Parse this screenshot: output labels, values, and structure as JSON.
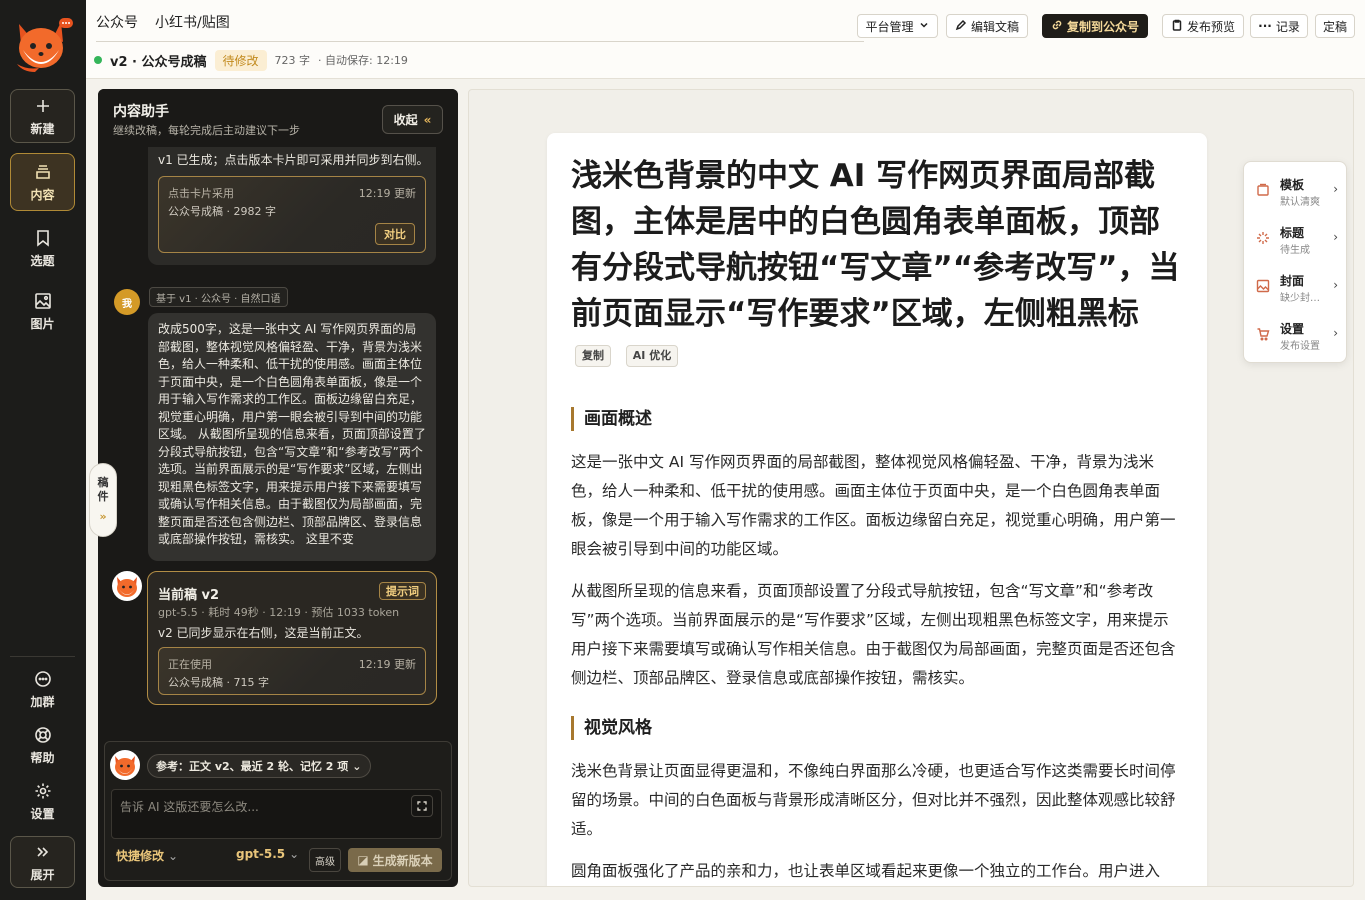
{
  "rail": {
    "new_label": "新建",
    "content_label": "内容",
    "topic_label": "选题",
    "image_label": "图片",
    "group_label": "加群",
    "help_label": "帮助",
    "settings_label": "设置",
    "expand_label": "展开"
  },
  "header": {
    "tabs": [
      "公众号",
      "小红书/贴图"
    ],
    "doc_title": "v2 · 公众号成稿",
    "status_badge": "待修改",
    "word_count": "723 字",
    "autosave": "· 自动保存: 12:19",
    "buttons": {
      "platform": "平台管理",
      "edit": "编辑文稿",
      "copy": "复制到公众号",
      "preview": "发布预览",
      "record": "记录",
      "finalize": "定稿"
    }
  },
  "assistant": {
    "title": "内容助手",
    "subtitle": "继续改稿，每轮完成后主动建议下一步",
    "collapse_label": "收起",
    "prev_message": "v1 已生成；点击版本卡片即可采用并同步到右侧。",
    "prev_card": {
      "label": "点击卡片采用",
      "time": "12:19 更新",
      "desc": "公众号成稿 · 2982 字",
      "compare_label": "对比"
    },
    "user_avatar": "我",
    "user_ref": "基于 v1 · 公众号 · 自然口语",
    "user_message": "改成500字，这是一张中文 AI 写作网页界面的局部截图，整体视觉风格偏轻盈、干净，背景为浅米色，给人一种柔和、低干扰的使用感。画面主体位于页面中央，是一个白色圆角表单面板，像是一个用于输入写作需求的工作区。面板边缘留白充足，视觉重心明确，用户第一眼会被引导到中间的功能区域。 从截图所呈现的信息来看，页面顶部设置了分段式导航按钮，包含“写文章”和“参考改写”两个选项。当前界面展示的是“写作要求”区域，左侧出现粗黑色标签文字，用来提示用户接下来需要填写或确认写作相关信息。由于截图仅为局部画面，完整页面是否还包含侧边栏、顶部品牌区、登录信息或底部操作按钮，需核实。 这里不变",
    "draft_tab": [
      "稿",
      "件"
    ],
    "current": {
      "title": "当前稿 v2",
      "tip_label": "提示词",
      "meta": "gpt-5.5 · 耗时 49秒 · 12:19 · 预估 1033 token",
      "desc": "v2 已同步显示在右侧，这是当前正文。",
      "card_label": "正在使用",
      "card_time": "12:19 更新",
      "card_desc": "公众号成稿 · 715 字"
    },
    "composer": {
      "ref_chip": "参考：正文 v2、最近 2 轮、记忆 2 项",
      "placeholder": "告诉 AI 这版还要怎么改...",
      "quick_label": "快捷修改",
      "model_label": "gpt-5.5",
      "advanced_label": "高级",
      "generate_label": "生成新版本"
    }
  },
  "article": {
    "title": "浅米色背景的中文 AI 写作网页界面局部截图，主体是居中的白色圆角表单面板，顶部有分段式导航按钮“写文章”“参考改写”，当前页面显示“写作要求”区域，左侧粗黑标",
    "copy_chip": "复制",
    "optimize_chip": "AI 优化",
    "sections": [
      {
        "heading": "画面概述",
        "paragraphs": [
          "这是一张中文 AI 写作网页界面的局部截图，整体视觉风格偏轻盈、干净，背景为浅米色，给人一种柔和、低干扰的使用感。画面主体位于页面中央，是一个白色圆角表单面板，像是一个用于输入写作需求的工作区。面板边缘留白充足，视觉重心明确，用户第一眼会被引导到中间的功能区域。",
          "从截图所呈现的信息来看，页面顶部设置了分段式导航按钮，包含“写文章”和“参考改写”两个选项。当前界面展示的是“写作要求”区域，左侧出现粗黑色标签文字，用来提示用户接下来需要填写或确认写作相关信息。由于截图仅为局部画面，完整页面是否还包含侧边栏、顶部品牌区、登录信息或底部操作按钮，需核实。"
        ]
      },
      {
        "heading": "视觉风格",
        "paragraphs": [
          "浅米色背景让页面显得更温和，不像纯白界面那么冷硬，也更适合写作这类需要长时间停留的场景。中间的白色面板与背景形成清晰区分，但对比并不强烈，因此整体观感比较舒适。",
          "圆角面板强化了产品的亲和力，也让表单区域看起来更像一个独立的工作台。用户进入"
        ]
      }
    ]
  },
  "float_panel": {
    "items": [
      {
        "title": "模板",
        "sub": "默认清爽"
      },
      {
        "title": "标题",
        "sub": "待生成"
      },
      {
        "title": "封面",
        "sub": "缺少封面图"
      },
      {
        "title": "设置",
        "sub": "发布设置"
      }
    ]
  },
  "colors": {
    "accent": "#c79733",
    "rail_bg": "#1c1c1a",
    "panel_bg": "#1a1917",
    "page_bg": "#f4f2ec",
    "status_dot": "#34b55a"
  }
}
